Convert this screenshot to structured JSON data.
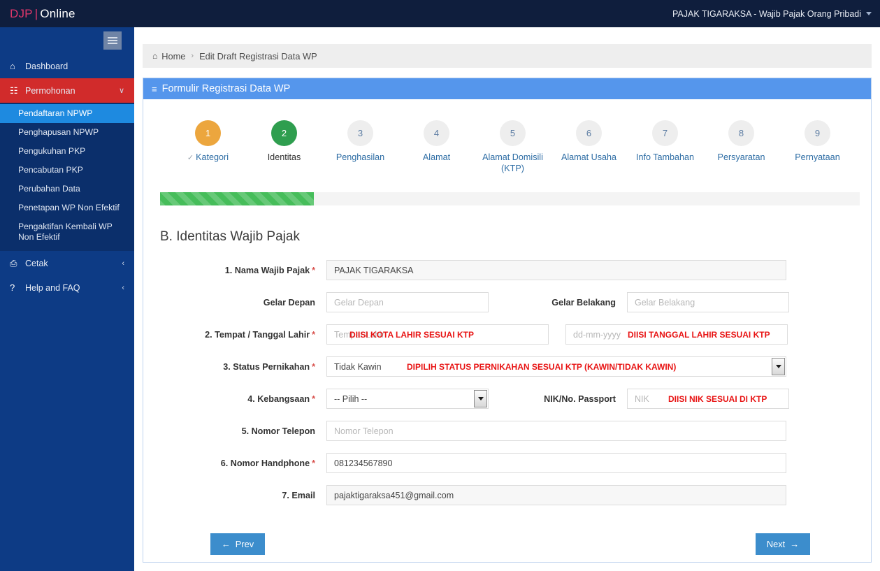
{
  "topbar": {
    "brand_djp": "DJP",
    "brand_sep": "|",
    "brand_online": "Online",
    "user": "PAJAK TIGARAKSA - Wajib Pajak Orang Pribadi"
  },
  "sidebar": {
    "items": [
      {
        "icon": "home-icon",
        "glyph": "⌂",
        "label": "Dashboard",
        "chev": ""
      },
      {
        "icon": "user-tie-icon",
        "glyph": "☷",
        "label": "Permohonan",
        "chev": "∨"
      },
      {
        "icon": "printer-icon",
        "glyph": "⎙",
        "label": "Cetak",
        "chev": "‹"
      },
      {
        "icon": "question-icon",
        "glyph": "?",
        "label": "Help and FAQ",
        "chev": "‹"
      }
    ],
    "submenu": [
      "Pendaftaran NPWP",
      "Penghapusan NPWP",
      "Pengukuhan PKP",
      "Pencabutan PKP",
      "Perubahan Data",
      "Penetapan WP Non Efektif",
      "Pengaktifan Kembali WP Non Efektif"
    ],
    "active_submenu_index": 0
  },
  "breadcrumb": {
    "home": "Home",
    "separator": "›",
    "current": "Edit Draft Registrasi Data WP"
  },
  "panel": {
    "title": "Formulir Registrasi Data WP",
    "bars_glyph": "≡"
  },
  "stepper": {
    "check_glyph": "✓",
    "steps": [
      {
        "num": "1",
        "label": "Kategori",
        "state": "done"
      },
      {
        "num": "2",
        "label": "Identitas",
        "state": "active"
      },
      {
        "num": "3",
        "label": "Penghasilan",
        "state": "todo"
      },
      {
        "num": "4",
        "label": "Alamat",
        "state": "todo"
      },
      {
        "num": "5",
        "label": "Alamat Domisili (KTP)",
        "state": "todo"
      },
      {
        "num": "6",
        "label": "Alamat Usaha",
        "state": "todo"
      },
      {
        "num": "7",
        "label": "Info Tambahan",
        "state": "todo"
      },
      {
        "num": "8",
        "label": "Persyaratan",
        "state": "todo"
      },
      {
        "num": "9",
        "label": "Pernyataan",
        "state": "todo"
      }
    ]
  },
  "progress": {
    "percent": 22
  },
  "form": {
    "section_title": "B. Identitas Wajib Pajak",
    "nama_label": "1. Nama Wajib Pajak",
    "nama_value": "PAJAK TIGARAKSA",
    "gelar_depan_label": "Gelar Depan",
    "gelar_depan_placeholder": "Gelar Depan",
    "gelar_belakang_label": "Gelar Belakang",
    "gelar_belakang_placeholder": "Gelar Belakang",
    "tempat_tanggal_label": "2. Tempat / Tanggal Lahir",
    "tempat_placeholder": "Tempat Lahir",
    "tempat_note": "DIISI KOTA LAHIR SESUAI KTP",
    "tanggal_placeholder": "dd-mm-yyyy",
    "tanggal_note": "DIISI TANGGAL LAHIR SESUAI KTP",
    "status_label": "3. Status Pernikahan",
    "status_value": "Tidak Kawin",
    "status_note": "DIPILIH STATUS PERNIKAHAN SESUAI KTP (KAWIN/TIDAK KAWIN)",
    "kebangsaan_label": "4. Kebangsaan",
    "kebangsaan_value": "-- Pilih --",
    "nik_label": "NIK/No. Passport",
    "nik_placeholder": "NIK",
    "nik_note": "DIISI NIK SESUAI DI KTP",
    "telepon_label": "5. Nomor Telepon",
    "telepon_placeholder": "Nomor Telepon",
    "handphone_label": "6. Nomor Handphone",
    "handphone_value": "081234567890",
    "email_label": "7. Email",
    "email_value": "pajaktigaraksa451@gmail.com",
    "required_mark": "*"
  },
  "buttons": {
    "prev": "Prev",
    "prev_arrow": "←",
    "next": "Next",
    "next_arrow": "→"
  },
  "colors": {
    "topbar": "#0f1e3d",
    "sidebar": "#0d3b85",
    "sidebar_active": "#1e8ae0",
    "permohonan_red": "#d12b2b",
    "panel_header": "#5596ec",
    "progress_green": "#46bd5a",
    "step_done": "#eca63e",
    "step_active": "#2f9e4f",
    "note_red": "#e81414",
    "button_blue": "#3c8dcc"
  }
}
